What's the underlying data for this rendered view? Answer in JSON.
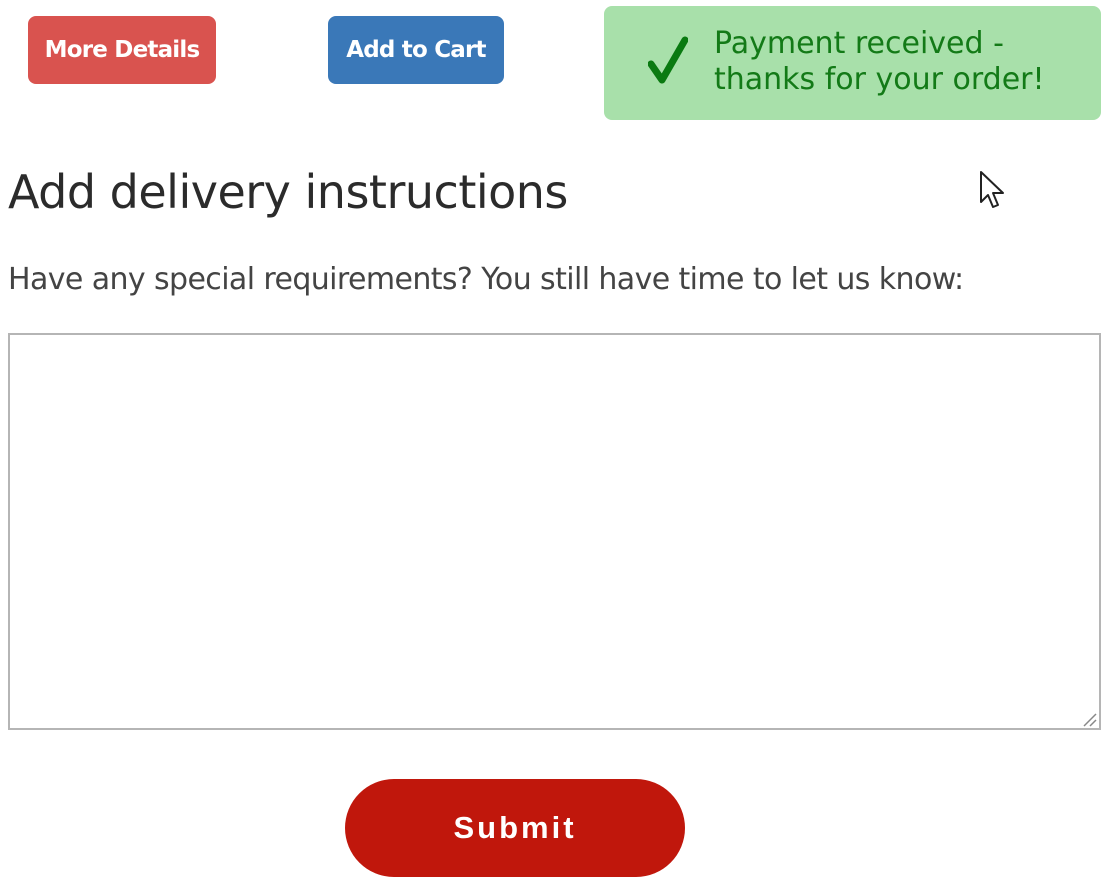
{
  "buttons": {
    "more_details": "More Details",
    "add_to_cart": "Add to Cart",
    "submit": "Submit"
  },
  "alert": {
    "icon": "checkmark-icon",
    "line1": "Payment received -",
    "line2": "thanks for your order!"
  },
  "form": {
    "heading": "Add delivery instructions",
    "prompt": "Have any special requirements? You still have time to let us know:",
    "instructions_value": ""
  },
  "colors": {
    "more_details_bg": "#d9534f",
    "add_to_cart_bg": "#3a78b8",
    "alert_bg": "#a8e0aa",
    "alert_text": "#137a17",
    "submit_bg": "#c0170c"
  }
}
